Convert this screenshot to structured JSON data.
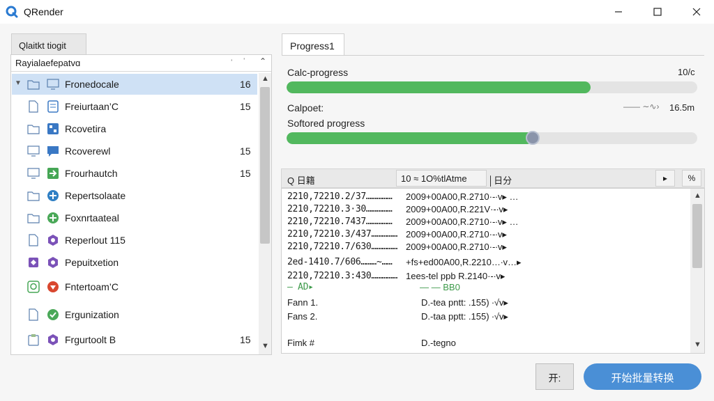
{
  "window": {
    "title": "QRender",
    "minimize_glyph": "—",
    "maximize_glyph": "☐",
    "close_glyph": "✕"
  },
  "left": {
    "tab_label": "Qlaitkt tiogit",
    "filter_label": "Rayialaefepatvɑ",
    "filter_sep": "ˈ",
    "filter_icon2": "ˈ",
    "filter_caret": "⌃",
    "items": [
      {
        "label": "Fronedocale",
        "count": "16",
        "icon": "folder-icon",
        "icon2": "monitor-icon",
        "color": "#3a78c4",
        "selected": true
      },
      {
        "label": "Freiurtaan’C",
        "count": "15",
        "icon": "document-icon",
        "icon2": "page-icon",
        "color": "#3a78c4",
        "selected": false
      },
      {
        "label": "Rcovetira",
        "count": "",
        "icon": "folder-icon",
        "icon2": "grid-icon",
        "color": "#3a78c4",
        "selected": false
      },
      {
        "label": "Rcoverewl",
        "count": "15",
        "icon": "monitor-icon",
        "icon2": "chat-icon",
        "color": "#3a78c4",
        "selected": false
      },
      {
        "label": "Frourhautch",
        "count": "15",
        "icon": "monitor-icon",
        "icon2": "arrow-icon",
        "color": "#46a655",
        "selected": false
      },
      {
        "label": "Repertsolaate",
        "count": "",
        "icon": "folder-icon",
        "icon2": "plus-icon",
        "color": "#2f7fc4",
        "selected": false
      },
      {
        "label": "Foxnrtaateal",
        "count": "",
        "icon": "folder-icon",
        "icon2": "plus-icon",
        "color": "#4aa858",
        "selected": false
      },
      {
        "label": "Reperlout 115",
        "count": "",
        "icon": "document-icon",
        "icon2": "hexagon-icon",
        "color": "#7b52b8",
        "selected": false
      },
      {
        "label": "Pepuitxetion",
        "count": "",
        "icon": "diamond-icon",
        "icon2": "hexagon-icon",
        "color": "#7b52b8",
        "selected": false
      },
      {
        "label": "Fntertoam’C",
        "count": "",
        "icon": "q-icon",
        "icon2": "heart-icon",
        "color": "#d9472f",
        "selected": false
      },
      {
        "label": "Ergunization",
        "count": "",
        "icon": "document-icon",
        "icon2": "check-icon",
        "color": "#4aa858",
        "selected": false
      },
      {
        "label": "Frgurtoolt B",
        "count": "15",
        "icon": "clipboard-icon",
        "icon2": "hexagon-icon",
        "color": "#7b52b8",
        "selected": false
      }
    ]
  },
  "right": {
    "tab_label": "Progress1",
    "calc_label": "Calc-progress",
    "calc_value": "10/c",
    "calc_fraction": 0.74,
    "calpoet_label": "Calpoet:",
    "calpoet_value": "16.5m",
    "soft_label": "Softored progress",
    "soft_fraction": 0.6,
    "accent": "#52b85e"
  },
  "log": {
    "toolbar_left": "Q 日籍",
    "toolbar_field": "10 ≈ 1Ο%tlAtme",
    "toolbar_field2": "│日分",
    "toolbar_arrow": "▸",
    "toolbar_pct": "%",
    "lines": [
      {
        "c1": "2210,72210.2/37……………",
        "c2": "2009+00A00,R.2710·-∙v▸ …"
      },
      {
        "c1": "2210,72210.3·30……………",
        "c2": "2009+00A00,R.221V·-∙v▸"
      },
      {
        "c1": "2210,72210.7437……………",
        "c2": "2009+00A00,R.2710·-∙v▸ …"
      },
      {
        "c1": "2210,72210.3/437……………",
        "c2": "2009+00A00,R.2710·-∙v▸"
      },
      {
        "c1": "2210,72210.7/630……………",
        "c2": "2009+00A00,R.2710·-∙v▸"
      },
      {
        "c1": "2ed-1410.7/606………~……",
        "c2": "+fs+ed00A00,R.2210…∙v…▸"
      },
      {
        "c1": "2210,72210.3:430……………",
        "c2": "1ees-tel ppb R.2140·-∙v▸"
      }
    ],
    "green_left": "— AD▸",
    "green_right": "— — BB0",
    "fans": [
      {
        "label": "Fann 1.",
        "value": "D.-tea pntt: .155)  ∙√v▸"
      },
      {
        "label": "Fans 2.",
        "value": "D.-taa pptt: .155)  ∙√v▸"
      },
      {
        "label": "Fimk #",
        "value": "D.-tegno"
      }
    ]
  },
  "buttons": {
    "small_label": "开:",
    "primary_label": "开始批量转换",
    "primary_color": "#4a8fd6"
  }
}
